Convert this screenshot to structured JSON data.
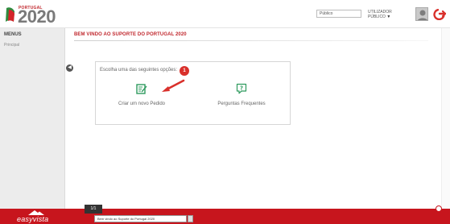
{
  "header": {
    "logo_small": "PORTUGAL",
    "logo_big": "2020",
    "search_value": "Público",
    "user_label": "UTILIZADOR PÚBLICO",
    "user_caret": "▼"
  },
  "sidebar": {
    "title": "MENUS",
    "items": [
      {
        "label": "Principal"
      }
    ]
  },
  "main": {
    "title": "BEM VINDO AO SUPORTE DO PORTUGAL 2020",
    "collapse_symbol": "◀",
    "prompt": "Escolha uma das seguintes opções:",
    "step_badge": "1",
    "options": [
      {
        "label": "Criar um novo Pedido",
        "icon": "edit-icon"
      },
      {
        "label": "Perguntas Frequentes",
        "icon": "faq-icon"
      }
    ]
  },
  "footer": {
    "brand": "easyvista",
    "page_indicator": "1/1",
    "tab_label": "Bem vindo ao Suporte do Portugal 2020"
  },
  "colors": {
    "brand_red": "#c7151d",
    "accent_green": "#2e9a5e",
    "title_red": "#c0272d"
  }
}
